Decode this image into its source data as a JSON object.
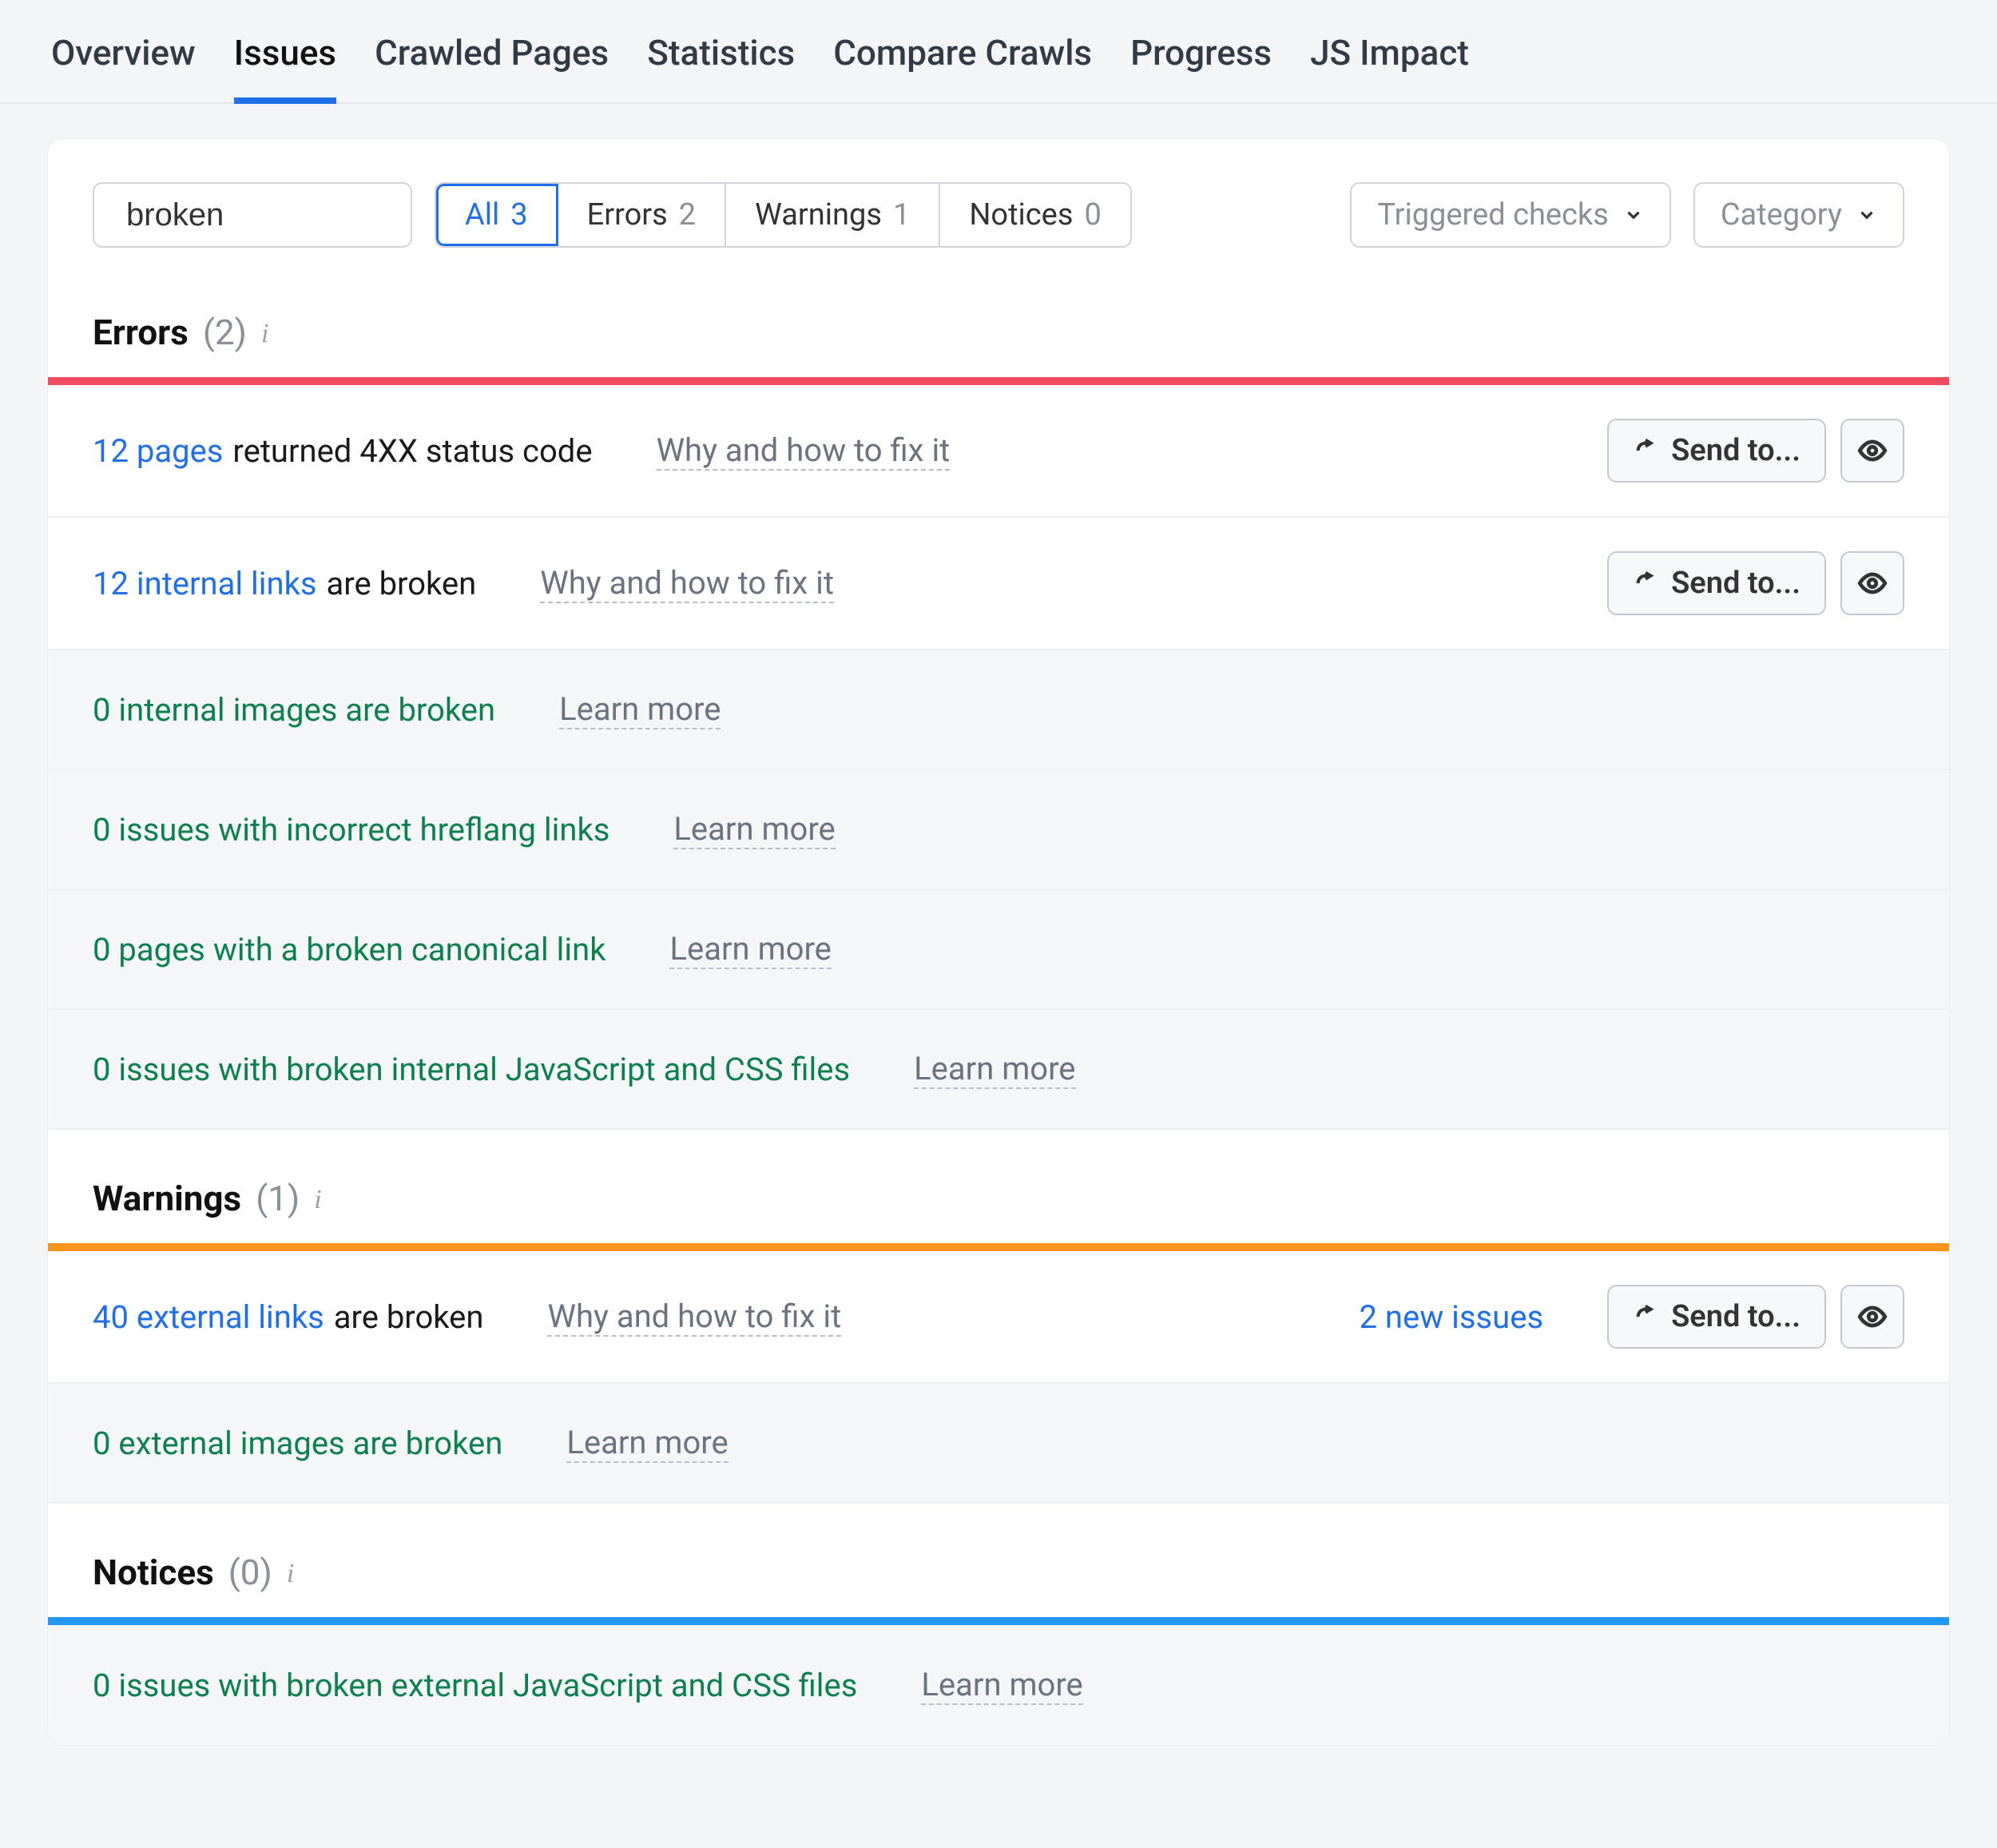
{
  "nav": {
    "tabs": [
      "Overview",
      "Issues",
      "Crawled Pages",
      "Statistics",
      "Compare Crawls",
      "Progress",
      "JS Impact"
    ],
    "active": "Issues"
  },
  "search": {
    "value": "broken"
  },
  "segmented": [
    {
      "label": "All",
      "count": "3",
      "active": true
    },
    {
      "label": "Errors",
      "count": "2",
      "active": false
    },
    {
      "label": "Warnings",
      "count": "1",
      "active": false
    },
    {
      "label": "Notices",
      "count": "0",
      "active": false
    }
  ],
  "dropdowns": {
    "triggered": "Triggered checks",
    "category": "Category"
  },
  "sections": {
    "errors": {
      "title": "Errors",
      "count": "(2)"
    },
    "warnings": {
      "title": "Warnings",
      "count": "(1)"
    },
    "notices": {
      "title": "Notices",
      "count": "(0)"
    }
  },
  "labels": {
    "why": "Why and how to fix it",
    "learn": "Learn more",
    "sendto": "Send to..."
  },
  "errors_rows": [
    {
      "link": "12 pages",
      "rest": "returned 4XX status code",
      "active": true,
      "help": "why"
    },
    {
      "link": "12 internal links",
      "rest": "are broken",
      "active": true,
      "help": "why"
    },
    {
      "passed": "0 internal images are broken",
      "active": false,
      "help": "learn"
    },
    {
      "passed": "0 issues with incorrect hreflang links",
      "active": false,
      "help": "learn"
    },
    {
      "passed": "0 pages with a broken canonical link",
      "active": false,
      "help": "learn"
    },
    {
      "passed": "0 issues with broken internal JavaScript and CSS files",
      "active": false,
      "help": "learn"
    }
  ],
  "warnings_rows": [
    {
      "link": "40 external links",
      "rest": "are broken",
      "active": true,
      "help": "why",
      "new": "2 new issues"
    },
    {
      "passed": "0 external images are broken",
      "active": false,
      "help": "learn"
    }
  ],
  "notices_rows": [
    {
      "passed": "0 issues with broken external JavaScript and CSS files",
      "active": false,
      "help": "learn"
    }
  ]
}
